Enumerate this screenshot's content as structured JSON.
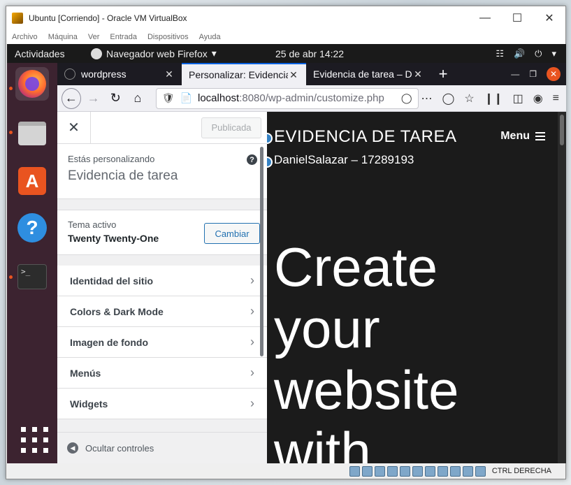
{
  "vbox": {
    "title": "Ubuntu [Corriendo] - Oracle VM VirtualBox",
    "menu": [
      "Archivo",
      "Máquina",
      "Ver",
      "Entrada",
      "Dispositivos",
      "Ayuda"
    ],
    "host_key": "CTRL DERECHA"
  },
  "gnome": {
    "activities": "Actividades",
    "app_menu": "Navegador web Firefox",
    "clock": "25 de abr  14:22"
  },
  "firefox": {
    "tabs": [
      {
        "label": "wordpress",
        "selected": false
      },
      {
        "label": "Personalizar: Evidencia de tarea",
        "selected": true
      },
      {
        "label": "Evidencia de tarea – DanielSalazar",
        "selected": false
      }
    ],
    "url_host": "localhost",
    "url_rest": ":8080/wp-admin/customize.php"
  },
  "customizer": {
    "publish_label": "Publicada",
    "customizing_label": "Estás personalizando",
    "site_name": "Evidencia de tarea",
    "active_theme_label": "Tema activo",
    "theme_name": "Twenty Twenty-One",
    "change_label": "Cambiar",
    "sections": [
      "Identidad del sitio",
      "Colors & Dark Mode",
      "Imagen de fondo",
      "Menús",
      "Widgets"
    ],
    "hide_controls": "Ocultar controles"
  },
  "preview": {
    "site_title": "EVIDENCIA DE TAREA",
    "site_description": "DanielSalazar – 17289193",
    "menu_label": "Menu",
    "hero_lines": [
      "Create",
      "your",
      "website",
      "with"
    ]
  },
  "colors": {
    "ubuntu_orange": "#e95420",
    "wp_blue": "#2271b1",
    "dock_bg": "#3c2330"
  }
}
